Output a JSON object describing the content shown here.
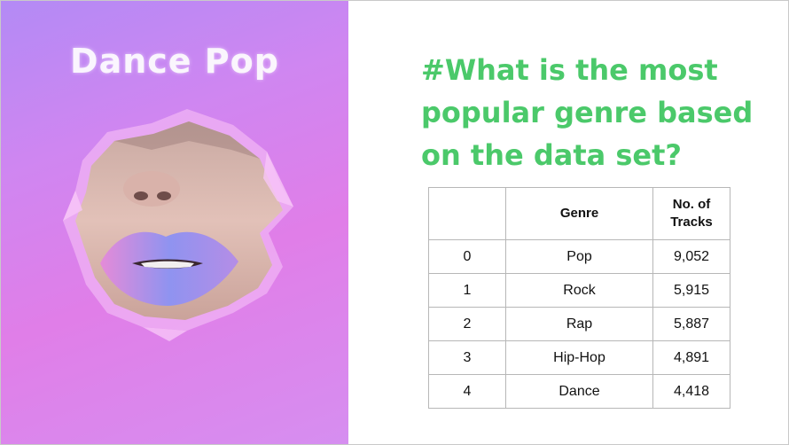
{
  "cover": {
    "title": "Dance Pop",
    "image": "torn-paper-lips-icon"
  },
  "heading": {
    "lines": [
      "#What is the most",
      "popular genre based",
      "on the data set?"
    ]
  },
  "table": {
    "headers": [
      "",
      "Genre",
      "No. of Tracks"
    ],
    "rows": [
      {
        "index": "0",
        "genre": "Pop",
        "tracks": "9,052"
      },
      {
        "index": "1",
        "genre": "Rock",
        "tracks": "5,915"
      },
      {
        "index": "2",
        "genre": "Rap",
        "tracks": "5,887"
      },
      {
        "index": "3",
        "genre": "Hip-Hop",
        "tracks": "4,891"
      },
      {
        "index": "4",
        "genre": "Dance",
        "tracks": "4,418"
      }
    ]
  },
  "colors": {
    "heading": "#4bc96a",
    "cover_bg": "#d886ef",
    "table_border": "#b7b7b7"
  }
}
